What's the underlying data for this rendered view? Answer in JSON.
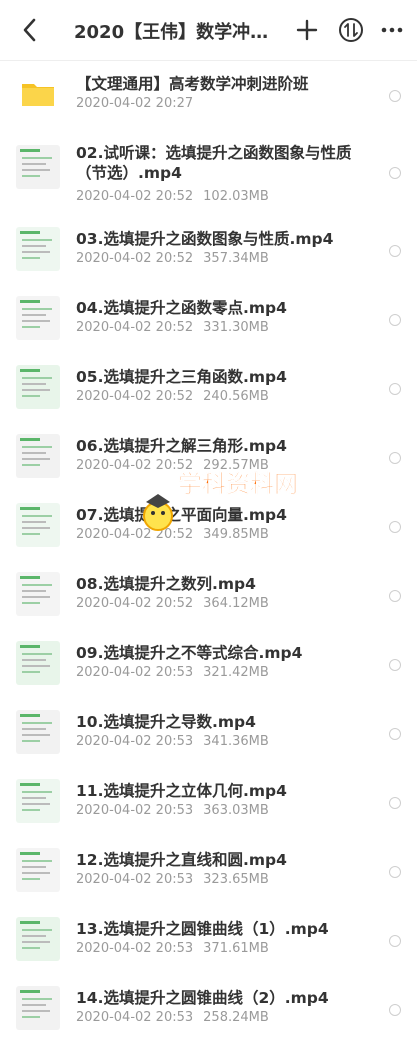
{
  "topbar": {
    "title": "2020【王伟】数学冲刺…",
    "icons": {
      "back": "back-chevron-icon",
      "add": "plus-icon",
      "sort": "sort-circle-icon",
      "more": "more-dots-icon"
    }
  },
  "items": [
    {
      "name": "【文理通用】高考数学冲刺进阶班",
      "date": "2020-04-02",
      "time": "20:27",
      "size": "",
      "type": "folder"
    },
    {
      "name": "02.试听课：选填提升之函数图象与性质（节选）.mp4",
      "date": "2020-04-02",
      "time": "20:52",
      "size": "102.03MB",
      "type": "video"
    },
    {
      "name": "03.选填提升之函数图象与性质.mp4",
      "date": "2020-04-02",
      "time": "20:52",
      "size": "357.34MB",
      "type": "video"
    },
    {
      "name": "04.选填提升之函数零点.mp4",
      "date": "2020-04-02",
      "time": "20:52",
      "size": "331.30MB",
      "type": "video"
    },
    {
      "name": "05.选填提升之三角函数.mp4",
      "date": "2020-04-02",
      "time": "20:52",
      "size": "240.56MB",
      "type": "video"
    },
    {
      "name": "06.选填提升之解三角形.mp4",
      "date": "2020-04-02",
      "time": "20:52",
      "size": "292.57MB",
      "type": "video"
    },
    {
      "name": "07.选填提升之平面向量.mp4",
      "date": "2020-04-02",
      "time": "20:52",
      "size": "349.85MB",
      "type": "video"
    },
    {
      "name": "08.选填提升之数列.mp4",
      "date": "2020-04-02",
      "time": "20:52",
      "size": "364.12MB",
      "type": "video"
    },
    {
      "name": "09.选填提升之不等式综合.mp4",
      "date": "2020-04-02",
      "time": "20:53",
      "size": "321.42MB",
      "type": "video"
    },
    {
      "name": "10.选填提升之导数.mp4",
      "date": "2020-04-02",
      "time": "20:53",
      "size": "341.36MB",
      "type": "video"
    },
    {
      "name": "11.选填提升之立体几何.mp4",
      "date": "2020-04-02",
      "time": "20:53",
      "size": "363.03MB",
      "type": "video"
    },
    {
      "name": "12.选填提升之直线和圆.mp4",
      "date": "2020-04-02",
      "time": "20:53",
      "size": "323.65MB",
      "type": "video"
    },
    {
      "name": "13.选填提升之圆锥曲线（1）.mp4",
      "date": "2020-04-02",
      "time": "20:53",
      "size": "371.61MB",
      "type": "video"
    },
    {
      "name": "14.选填提升之圆锥曲线（2）.mp4",
      "date": "2020-04-02",
      "time": "20:53",
      "size": "258.24MB",
      "type": "video"
    }
  ],
  "watermark": {
    "text": "学科资料网",
    "colors": [
      "#ff6a00",
      "#ffd400"
    ]
  },
  "colors": {
    "folder": "#f6c325",
    "meta": "#9a9a9a",
    "title": "#333333"
  }
}
